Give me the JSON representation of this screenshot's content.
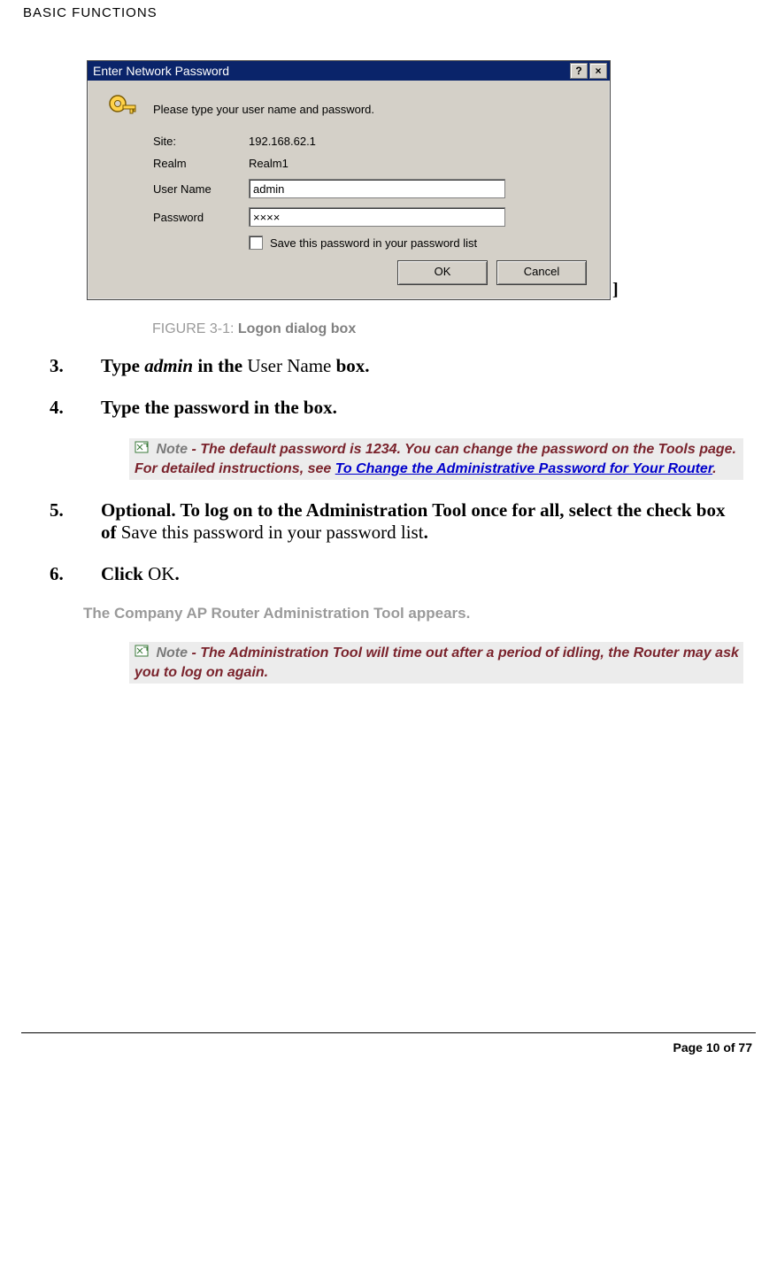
{
  "header": "BASIC FUNCTIONS",
  "dialog": {
    "title": "Enter Network Password",
    "help_btn": "?",
    "close_btn": "×",
    "prompt": "Please type your user name and password.",
    "site_label": "Site:",
    "site_value": "192.168.62.1",
    "realm_label": "Realm",
    "realm_value": "Realm1",
    "username_label": "User Name",
    "username_value": "admin",
    "password_label": "Password",
    "password_value": "××××",
    "save_label": "Save this password in your password list",
    "ok": "OK",
    "cancel": "Cancel"
  },
  "caption_prefix": "FIGURE 3-1: ",
  "caption_text": "Logon dialog box",
  "steps": {
    "s3_num": "3.",
    "s3_a": "Type ",
    "s3_b": "admin",
    "s3_c": " in the ",
    "s3_d": "User Name ",
    "s3_e": "box.",
    "s4_num": "4.",
    "s4_text": "Type the password in the box.",
    "s5_num": "5.",
    "s5_a": "Optional. To log on to the Administration Tool once for all, select the check box of ",
    "s5_b": "Save this password in your password list",
    "s5_c": ".",
    "s6_num": "6.",
    "s6_a": "Click ",
    "s6_b": "OK",
    "s6_c": "."
  },
  "note1": {
    "word": " Note",
    "a": " - The default password is ",
    "b": "1234",
    "c": ". You can change the password on the Tools page. For detailed instructions, see ",
    "link": "To Change the Administrative Password for Your Router",
    "d": "."
  },
  "result": "The Company AP Router Administration Tool appears.",
  "note2": {
    "word": " Note",
    "a": " - The Administration Tool will time out after a period of idling, the Router may ask you to log on again."
  },
  "footer": "Page 10 of 77",
  "trailing_bracket": "]"
}
